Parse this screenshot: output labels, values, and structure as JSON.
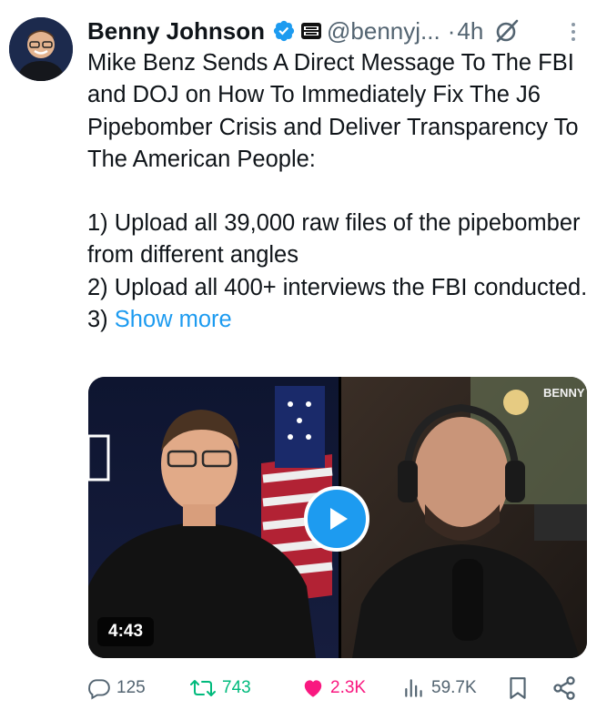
{
  "tweet": {
    "author_name": "Benny Johnson",
    "handle": "@bennyj...",
    "separator": "·",
    "time": "4h",
    "text_intro": "Mike Benz Sends A Direct Message To The FBI and DOJ on How To Immediately Fix The J6 Pipebomber Crisis and Deliver Transparency To The American People:",
    "list_items": [
      "1) Upload all 39,000 raw files of the pipebomber from different angles",
      "2) Upload all 400+ interviews the FBI conducted."
    ],
    "truncated_prefix": "3) ",
    "show_more": "Show more"
  },
  "media": {
    "duration": "4:43",
    "watermark": "BENNY SHOW"
  },
  "actions": {
    "replies": "125",
    "reposts": "743",
    "likes": "2.3K",
    "views": "59.7K"
  },
  "icons": {
    "verified": "verified-badge-icon",
    "affiliate": "affiliate-logo-icon",
    "grok": "grok-icon",
    "more": "more-options-icon",
    "reply": "reply-icon",
    "retweet": "retweet-icon",
    "like": "heart-icon",
    "views": "views-icon",
    "bookmark": "bookmark-icon",
    "share": "share-icon",
    "play": "play-icon"
  },
  "colors": {
    "accent": "#1d9bf0",
    "retweet": "#00ba7c",
    "like": "#f91880",
    "muted": "#536471",
    "text": "#0f1419"
  }
}
